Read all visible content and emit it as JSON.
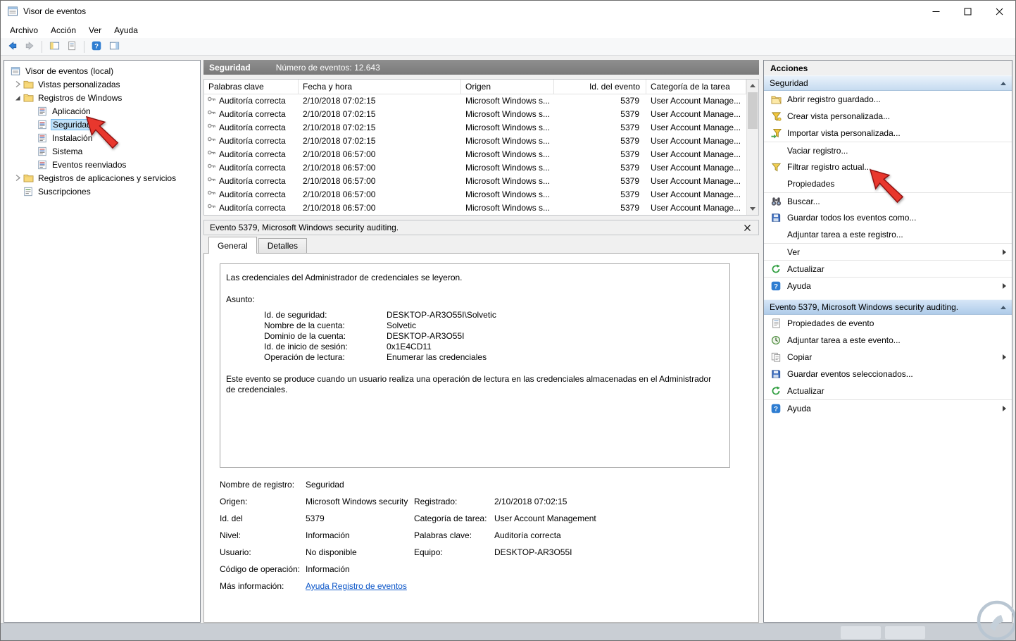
{
  "titlebar": {
    "title": "Visor de eventos"
  },
  "menubar": {
    "items": [
      "Archivo",
      "Acción",
      "Ver",
      "Ayuda"
    ]
  },
  "tree": {
    "root": "Visor de eventos (local)",
    "items": [
      {
        "label": "Vistas personalizadas"
      },
      {
        "label": "Registros de Windows"
      },
      {
        "label": "Aplicación"
      },
      {
        "label": "Seguridad"
      },
      {
        "label": "Instalación"
      },
      {
        "label": "Sistema"
      },
      {
        "label": "Eventos reenviados"
      },
      {
        "label": "Registros de aplicaciones y servicios"
      },
      {
        "label": "Suscripciones"
      }
    ]
  },
  "log": {
    "title": "Seguridad",
    "count": "Número de eventos: 12.643",
    "columns": [
      "Palabras clave",
      "Fecha y hora",
      "Origen",
      "Id. del evento",
      "Categoría de la tarea"
    ],
    "rows": [
      {
        "keywords": "Auditoría correcta",
        "date": "2/10/2018 07:02:15",
        "source": "Microsoft Windows s...",
        "event_id": "5379",
        "category": "User Account Manage..."
      },
      {
        "keywords": "Auditoría correcta",
        "date": "2/10/2018 07:02:15",
        "source": "Microsoft Windows s...",
        "event_id": "5379",
        "category": "User Account Manage..."
      },
      {
        "keywords": "Auditoría correcta",
        "date": "2/10/2018 07:02:15",
        "source": "Microsoft Windows s...",
        "event_id": "5379",
        "category": "User Account Manage..."
      },
      {
        "keywords": "Auditoría correcta",
        "date": "2/10/2018 07:02:15",
        "source": "Microsoft Windows s...",
        "event_id": "5379",
        "category": "User Account Manage..."
      },
      {
        "keywords": "Auditoría correcta",
        "date": "2/10/2018 06:57:00",
        "source": "Microsoft Windows s...",
        "event_id": "5379",
        "category": "User Account Manage..."
      },
      {
        "keywords": "Auditoría correcta",
        "date": "2/10/2018 06:57:00",
        "source": "Microsoft Windows s...",
        "event_id": "5379",
        "category": "User Account Manage..."
      },
      {
        "keywords": "Auditoría correcta",
        "date": "2/10/2018 06:57:00",
        "source": "Microsoft Windows s...",
        "event_id": "5379",
        "category": "User Account Manage..."
      },
      {
        "keywords": "Auditoría correcta",
        "date": "2/10/2018 06:57:00",
        "source": "Microsoft Windows s...",
        "event_id": "5379",
        "category": "User Account Manage..."
      },
      {
        "keywords": "Auditoría correcta",
        "date": "2/10/2018 06:57:00",
        "source": "Microsoft Windows s...",
        "event_id": "5379",
        "category": "User Account Manage..."
      }
    ]
  },
  "detail": {
    "title": "Evento 5379, Microsoft Windows security auditing.",
    "tabs": [
      "General",
      "Detalles"
    ],
    "message": "Las credenciales del Administrador de credenciales se leyeron.",
    "subject_heading": "Asunto:",
    "subject": [
      {
        "label": "Id. de seguridad:",
        "value": "DESKTOP-AR3O55I\\Solvetic"
      },
      {
        "label": "Nombre de la cuenta:",
        "value": "Solvetic"
      },
      {
        "label": "Dominio de la cuenta:",
        "value": "DESKTOP-AR3O55I"
      },
      {
        "label": "Id. de inicio de sesión:",
        "value": "0x1E4CD11"
      },
      {
        "label": "Operación de lectura:",
        "value": "Enumerar las credenciales"
      }
    ],
    "note": "Este evento se produce cuando un usuario realiza una operación de lectura en las credenciales almacenadas en el Administrador de credenciales.",
    "fields": {
      "log_name_label": "Nombre de registro:",
      "log_name": "Seguridad",
      "source_label": "Origen:",
      "source": "Microsoft Windows security",
      "logged_label": "Registrado:",
      "logged": "2/10/2018 07:02:15",
      "event_id_label": "Id. del",
      "event_id": "5379",
      "task_cat_label": "Categoría de tarea:",
      "task_cat": "User Account Management",
      "level_label": "Nivel:",
      "level": "Información",
      "keywords_label": "Palabras clave:",
      "keywords": "Auditoría correcta",
      "user_label": "Usuario:",
      "user": "No disponible",
      "computer_label": "Equipo:",
      "computer": "DESKTOP-AR3O55I",
      "opcode_label": "Código de operación:",
      "opcode": "Información",
      "more_info_label": "Más información:",
      "more_info_link": "Ayuda Registro de eventos"
    }
  },
  "actions": {
    "title": "Acciones",
    "sections": [
      {
        "header": "Seguridad",
        "items": [
          {
            "label": "Abrir registro guardado...",
            "icon": "open-saved-log-icon"
          },
          {
            "label": "Crear vista personalizada...",
            "icon": "create-custom-view-icon"
          },
          {
            "label": "Importar vista personalizada...",
            "icon": "import-custom-view-icon"
          },
          {
            "label": "Vaciar registro..."
          },
          {
            "label": "Filtrar registro actual...",
            "icon": "filter-icon"
          },
          {
            "label": "Propiedades"
          },
          {
            "label": "Buscar...",
            "icon": "find-icon"
          },
          {
            "label": "Guardar todos los eventos como...",
            "icon": "save-icon"
          },
          {
            "label": "Adjuntar tarea a este registro..."
          },
          {
            "label": "Ver",
            "submenu": true
          },
          {
            "label": "Actualizar",
            "icon": "refresh-icon"
          },
          {
            "label": "Ayuda",
            "icon": "help-icon",
            "submenu": true
          }
        ]
      },
      {
        "header": "Evento 5379, Microsoft Windows security auditing.",
        "items": [
          {
            "label": "Propiedades de evento",
            "icon": "event-properties-icon"
          },
          {
            "label": "Adjuntar tarea a este evento...",
            "icon": "attach-task-icon"
          },
          {
            "label": "Copiar",
            "icon": "copy-icon",
            "submenu": true
          },
          {
            "label": "Guardar eventos seleccionados...",
            "icon": "save-icon"
          },
          {
            "label": "Actualizar",
            "icon": "refresh-icon"
          },
          {
            "label": "Ayuda",
            "icon": "help-icon",
            "submenu": true
          }
        ]
      }
    ]
  },
  "colors": {
    "selection_blue": "#bfe0f7",
    "link_blue": "#0a55c8",
    "annotation_red": "#e8372d",
    "section_header_blue": "#c6dbf0"
  }
}
